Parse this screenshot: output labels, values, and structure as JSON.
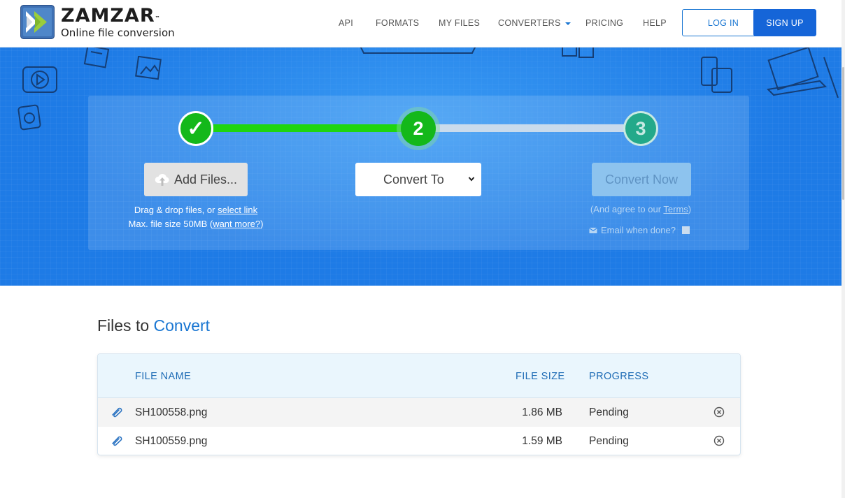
{
  "brand": {
    "name": "ZAMZAR",
    "tm": "™",
    "tagline": "Online file conversion"
  },
  "nav": {
    "items": [
      "API",
      "FORMATS",
      "MY FILES",
      "CONVERTERS",
      "PRICING",
      "HELP"
    ],
    "login": "LOG IN",
    "signup": "SIGN UP"
  },
  "steps": {
    "step1": "✓",
    "step2": "2",
    "step3": "3"
  },
  "upload": {
    "add_files": "Add Files...",
    "drag_text": "Drag & drop files, or ",
    "select_link": "select link",
    "max_text": "Max. file size 50MB (",
    "want_more": "want more?",
    "max_close": ")"
  },
  "convert": {
    "select_value": "Convert To",
    "convert_now": "Convert Now",
    "agree_prefix": "(And agree to our ",
    "terms_link": "Terms",
    "agree_suffix": ")",
    "email_label": "Email when done?"
  },
  "files": {
    "title_plain": "Files to ",
    "title_accent": "Convert",
    "headers": {
      "name": "FILE NAME",
      "size": "FILE SIZE",
      "progress": "PROGRESS"
    },
    "rows": [
      {
        "name": "SH100558.png",
        "size": "1.86 MB",
        "status": "Pending"
      },
      {
        "name": "SH100559.png",
        "size": "1.59 MB",
        "status": "Pending"
      }
    ]
  },
  "colors": {
    "brand_blue": "#1976d2",
    "hero_blue": "#1e7be6",
    "step_green": "#14b81a",
    "progress_green": "#1fd50f"
  }
}
